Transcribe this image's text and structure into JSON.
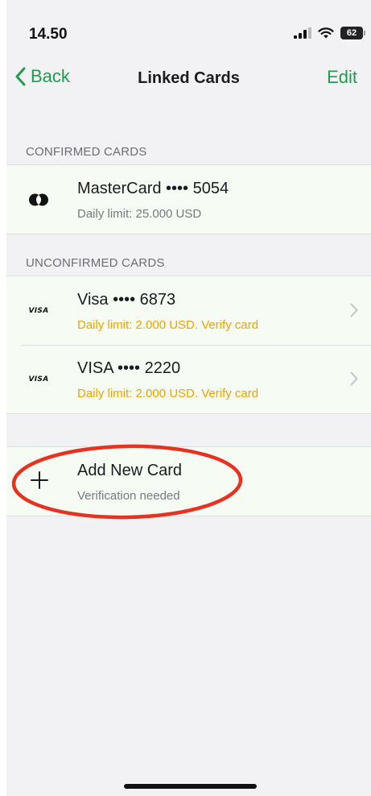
{
  "status_bar": {
    "time": "14.50",
    "battery_level": "62"
  },
  "nav": {
    "back_label": "Back",
    "title": "Linked Cards",
    "edit_label": "Edit"
  },
  "confirmed": {
    "header": "CONFIRMED CARDS",
    "cards": [
      {
        "icon": "mastercard-icon",
        "title": "MasterCard •••• 5054",
        "subtitle": "Daily limit: 25.000 USD"
      }
    ]
  },
  "unconfirmed": {
    "header": "UNCONFIRMED CARDS",
    "cards": [
      {
        "logo": "VISA",
        "title": "Visa •••• 6873",
        "subtitle": "Daily limit: 2.000 USD. Verify card"
      },
      {
        "logo": "VISA",
        "title": "VISA •••• 2220",
        "subtitle": "Daily limit: 2.000 USD. Verify card"
      }
    ]
  },
  "add_card": {
    "icon": "plus-icon",
    "title": "Add New Card",
    "subtitle": "Verification needed"
  },
  "colors": {
    "accent": "#1f9d4c",
    "warning": "#f0a400",
    "annotation": "#e8321f",
    "row_background": "#f6fbf4",
    "screen_background": "#f2f2f5"
  }
}
